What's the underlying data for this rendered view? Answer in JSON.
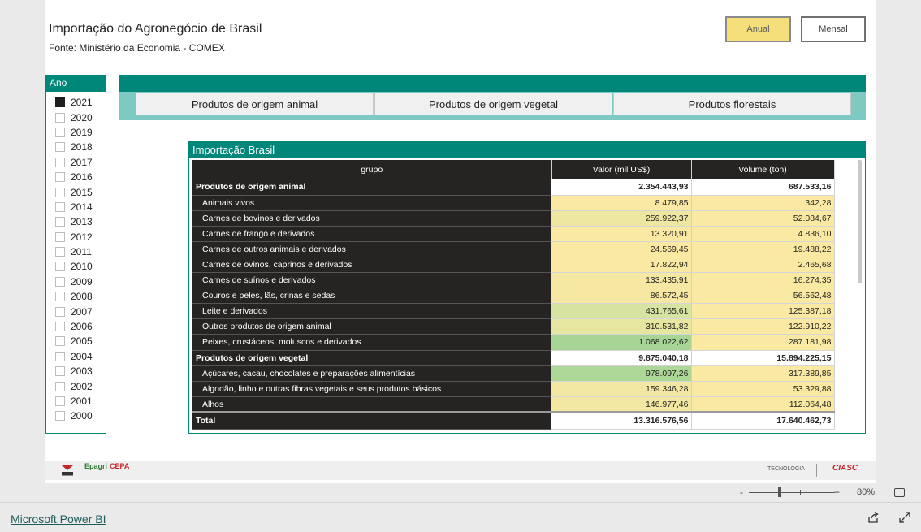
{
  "report": {
    "title": "Importação do Agronegócio de Brasil",
    "source": "Fonte:  Ministério da Economia - COMEX"
  },
  "toggle": {
    "anual": "Anual",
    "mensal": "Mensal"
  },
  "slicer": {
    "title": "Ano",
    "years": [
      "2021",
      "2020",
      "2019",
      "2018",
      "2017",
      "2016",
      "2015",
      "2014",
      "2013",
      "2012",
      "2011",
      "2010",
      "2009",
      "2008",
      "2007",
      "2006",
      "2005",
      "2004",
      "2003",
      "2002",
      "2001",
      "2000"
    ],
    "selected": "2021"
  },
  "tabs": [
    "Produtos de origem animal",
    "Produtos de origem vegetal",
    "Produtos florestais"
  ],
  "table": {
    "title": "Importação Brasil",
    "columns": [
      "grupo",
      "Valor (mil US$)",
      "Volume (ton)"
    ],
    "rows": [
      {
        "grupo": "Produtos de origem animal",
        "valor": "2.354.443,93",
        "volume": "687.533,16",
        "group": true
      },
      {
        "grupo": "Animais vivos",
        "valor": "8.479,85",
        "volume": "342,28",
        "valor_color": "#fae9a3"
      },
      {
        "grupo": "Carnes de bovinos e derivados",
        "valor": "259.922,37",
        "volume": "52.084,67",
        "valor_color": "#eee7a2"
      },
      {
        "grupo": "Carnes de frango e derivados",
        "valor": "13.320,91",
        "volume": "4.836,10",
        "valor_color": "#fae9a3"
      },
      {
        "grupo": "Carnes de outros animais e derivados",
        "valor": "24.569,45",
        "volume": "19.488,22",
        "valor_color": "#fae9a3"
      },
      {
        "grupo": "Carnes de ovinos, caprinos e derivados",
        "valor": "17.822,94",
        "volume": "2.465,68",
        "valor_color": "#fae9a3"
      },
      {
        "grupo": "Carnes de suínos e derivados",
        "valor": "133.435,91",
        "volume": "16.274,35",
        "valor_color": "#f4e8a3"
      },
      {
        "grupo": "Couros e peles, lãs, crinas e sedas",
        "valor": "86.572,45",
        "volume": "56.562,48",
        "valor_color": "#f6e8a3"
      },
      {
        "grupo": "Leite e derivados",
        "valor": "431.765,61",
        "volume": "125.387,18",
        "valor_color": "#d7e3a0"
      },
      {
        "grupo": "Outros produtos de origem animal",
        "valor": "310.531,82",
        "volume": "122.910,22",
        "valor_color": "#e6e6a1"
      },
      {
        "grupo": "Peixes, crustáceos, moluscos e derivados",
        "valor": "1.068.022,62",
        "volume": "287.181,98",
        "valor_color": "#a6d595"
      },
      {
        "grupo": "Produtos de origem vegetal",
        "valor": "9.875.040,18",
        "volume": "15.894.225,15",
        "group": true
      },
      {
        "grupo": "Açúcares, cacau, chocolates e preparações alimentícias",
        "valor": "978.097,26",
        "volume": "317.389,85",
        "valor_color": "#acd796"
      },
      {
        "grupo": "Algodão, linho e outras fibras vegetais e seus produtos básicos",
        "valor": "159.346,28",
        "volume": "53.329,88",
        "valor_color": "#f2e8a3"
      },
      {
        "grupo": "Alhos",
        "valor": "146.977,46",
        "volume": "112.064,48",
        "valor_color": "#f2e8a3"
      }
    ],
    "total": {
      "label": "Total",
      "valor": "13.316.576,56",
      "volume": "17.640.462,73"
    },
    "volume_color": "#fae9a3"
  },
  "footer": {
    "tecnologia": "TECNOLOGIA",
    "epagri": "Epagri",
    "cepa": "CEPA",
    "ciasc": "CIASC"
  },
  "zoom": {
    "minus": "-",
    "plus": "+",
    "level": "80%"
  },
  "brand": "Microsoft Power BI"
}
